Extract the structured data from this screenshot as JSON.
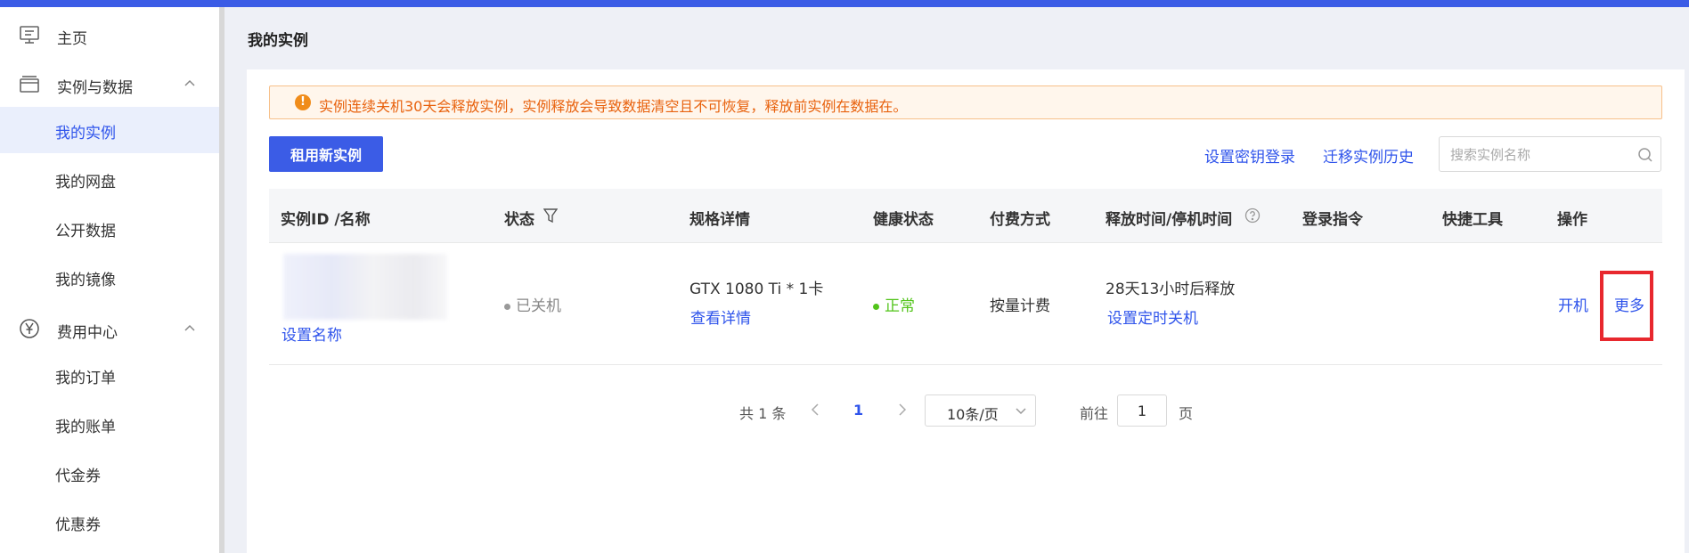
{
  "sidebar": {
    "home": "主页",
    "group_instances": "实例与数据",
    "my_instances": "我的实例",
    "my_disk": "我的网盘",
    "public_data": "公开数据",
    "my_images": "我的镜像",
    "group_billing": "费用中心",
    "my_orders": "我的订单",
    "my_bills": "我的账单",
    "vouchers": "代金券",
    "coupons": "优惠券"
  },
  "page": {
    "title": "我的实例"
  },
  "alert": {
    "text": "实例连续关机30天会释放实例，实例释放会导致数据清空且不可恢复，释放前实例在数据在。"
  },
  "toolbar": {
    "new_instance": "租用新实例",
    "key_login": "设置密钥登录",
    "migrate_history": "迁移实例历史",
    "search_placeholder": "搜索实例名称"
  },
  "table": {
    "headers": {
      "id_name": "实例ID /名称",
      "status": "状态",
      "spec": "规格详情",
      "health": "健康状态",
      "payment": "付费方式",
      "release": "释放时间/停机时间",
      "login_cmd": "登录指令",
      "tools": "快捷工具",
      "actions": "操作"
    },
    "row": {
      "set_name": "设置名称",
      "status": "已关机",
      "spec": "GTX 1080 Ti * 1卡",
      "view_details": "查看详情",
      "health": "正常",
      "payment": "按量计费",
      "release": "28天13小时后释放",
      "set_shutdown": "设置定时关机",
      "power_on": "开机",
      "more": "更多"
    }
  },
  "pagination": {
    "total": "共 1 条",
    "current": "1",
    "page_size": "10条/页",
    "goto_prefix": "前往",
    "goto_value": "1",
    "goto_suffix": "页"
  }
}
